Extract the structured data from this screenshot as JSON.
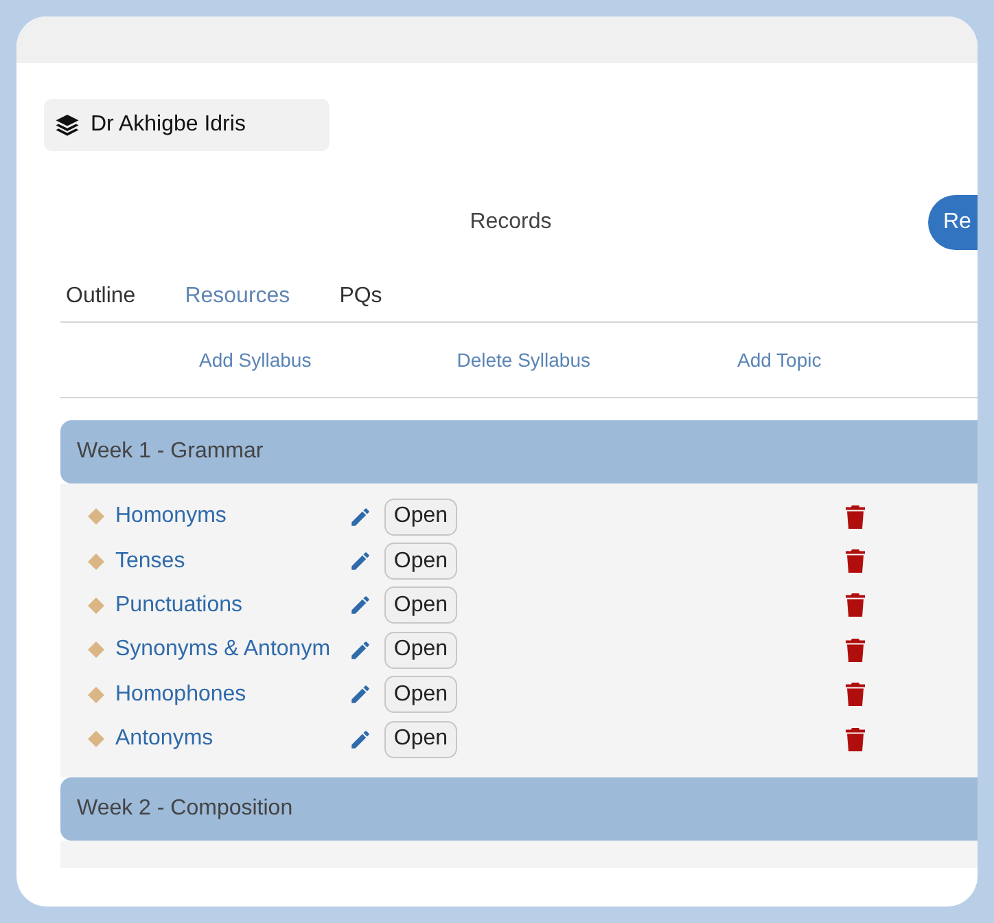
{
  "user": {
    "name": "Dr Akhigbe Idris"
  },
  "heading": "Records",
  "header_button": "Re",
  "tabs": [
    {
      "label": "Outline",
      "selected": false
    },
    {
      "label": "Resources",
      "selected": true
    },
    {
      "label": "PQs",
      "selected": false
    }
  ],
  "actions": [
    "Add Syllabus",
    "Delete Syllabus",
    "Add Topic"
  ],
  "weeks": [
    {
      "title": "Week 1 - Grammar",
      "topics": [
        {
          "name": "Homonyms",
          "button": "Open"
        },
        {
          "name": "Tenses",
          "button": "Open"
        },
        {
          "name": "Punctuations",
          "button": "Open"
        },
        {
          "name": "Synonyms & Antonym",
          "button": "Open"
        },
        {
          "name": "Homophones",
          "button": "Open"
        },
        {
          "name": "Antonyms",
          "button": "Open"
        }
      ]
    },
    {
      "title": "Week 2 - Composition"
    }
  ]
}
